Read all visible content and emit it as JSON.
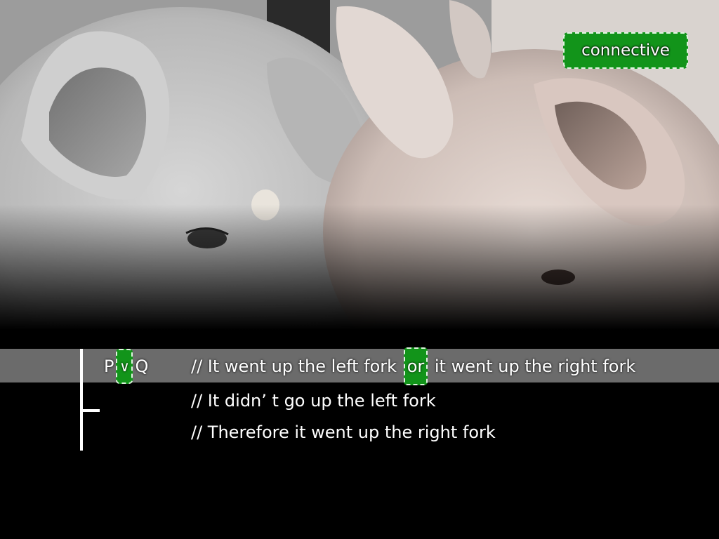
{
  "label": {
    "connective": "connective"
  },
  "argument": {
    "formula": {
      "p": "P",
      "operator": "∨",
      "q": "Q"
    },
    "premise1": {
      "before": "// It went up the left fork ",
      "keyword": "or",
      "after": " it went up the right fork"
    },
    "premise2": "// It didn’ t go up the left fork",
    "conclusion": "// Therefore it went up the right fork"
  },
  "colors": {
    "accent_green": "#12941a",
    "highlight_band": "#6b6b6b",
    "background": "#000000"
  },
  "icons": {
    "turnstile": "turnstile-icon"
  }
}
